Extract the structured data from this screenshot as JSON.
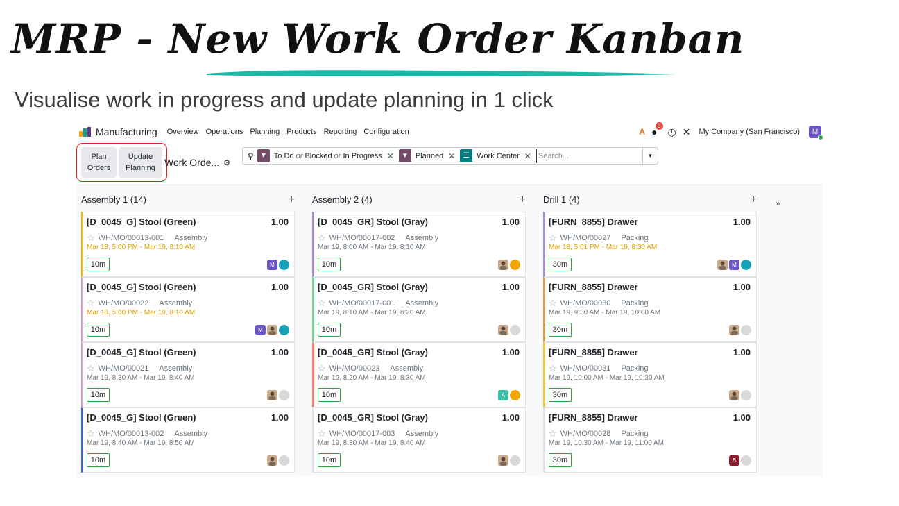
{
  "slide": {
    "title": "MRP - New Work Order Kanban",
    "subtitle": "Visualise work in progress and update planning in 1 click"
  },
  "navbar": {
    "app_name": "Manufacturing",
    "menu": [
      "Overview",
      "Operations",
      "Planning",
      "Products",
      "Reporting",
      "Configuration"
    ],
    "chat_badge": "3",
    "company": "My Company (San Francisco)",
    "user_initial": "M"
  },
  "control": {
    "plan_orders": [
      "Plan",
      "Orders"
    ],
    "update_planning": [
      "Update",
      "Planning"
    ],
    "breadcrumb": "Work Orde..."
  },
  "search": {
    "facets": [
      {
        "parts": [
          "To Do",
          " or ",
          "Blocked",
          " or ",
          "In Progress"
        ],
        "color": "#714B67",
        "icon": "filter-icon"
      },
      {
        "parts": [
          "Planned"
        ],
        "color": "#714B67",
        "icon": "filter-icon"
      },
      {
        "parts": [
          "Work Center"
        ],
        "color": "#017E84",
        "icon": "layers-icon"
      }
    ],
    "placeholder": "Search..."
  },
  "colors": {
    "accent": "#714B67",
    "teal": "#017E84",
    "highlight": "#e02020",
    "brush": "#1bb9a6",
    "late": "#e0a000",
    "duration_border": "#28a745"
  },
  "columns": [
    {
      "title": "Assembly 1 (14)",
      "cards": [
        {
          "title": "[D_0045_G] Stool (Green)",
          "qty": "1.00",
          "ref": "WH/MO/00013-001",
          "wc": "Assembly",
          "date": "Mar 18, 5:00 PM  -  Mar 19, 8:10 AM",
          "late": true,
          "duration": "10m",
          "color": "#f0b429",
          "avatars": [
            {
              "type": "initial",
              "text": "M",
              "color": "#6c56c4"
            },
            {
              "type": "dot",
              "color": "#17a2b8"
            }
          ]
        },
        {
          "title": "[D_0045_G] Stool (Green)",
          "qty": "1.00",
          "ref": "WH/MO/00022",
          "wc": "Assembly",
          "date": "Mar 18, 5:00 PM  -  Mar 19, 8:10 AM",
          "late": true,
          "duration": "10m",
          "color": "#c9a2c1",
          "avatars": [
            {
              "type": "initial",
              "text": "M",
              "color": "#6c56c4"
            },
            {
              "type": "photo"
            },
            {
              "type": "dot",
              "color": "#17a2b8"
            }
          ]
        },
        {
          "title": "[D_0045_G] Stool (Green)",
          "qty": "1.00",
          "ref": "WH/MO/00021",
          "wc": "Assembly",
          "date": "Mar 19, 8:30 AM  -  Mar 19, 8:40 AM",
          "late": false,
          "duration": "10m",
          "color": "#c9a2c1",
          "avatars": [
            {
              "type": "photo"
            },
            {
              "type": "dot",
              "color": "#d9d9d9"
            }
          ]
        },
        {
          "title": "[D_0045_G] Stool (Green)",
          "qty": "1.00",
          "ref": "WH/MO/00013-002",
          "wc": "Assembly",
          "date": "Mar 19, 8:40 AM  -  Mar 19, 8:50 AM",
          "late": false,
          "duration": "10m",
          "color": "#4a63c7",
          "avatars": [
            {
              "type": "photo"
            },
            {
              "type": "dot",
              "color": "#d9d9d9"
            }
          ]
        }
      ]
    },
    {
      "title": "Assembly 2 (4)",
      "cards": [
        {
          "title": "[D_0045_GR] Stool (Gray)",
          "qty": "1.00",
          "ref": "WH/MO/00017-002",
          "wc": "Assembly",
          "date": "Mar 19, 8:00 AM  -  Mar 19, 8:10 AM",
          "late": false,
          "duration": "10m",
          "color": "#a78bd4",
          "avatars": [
            {
              "type": "photo"
            },
            {
              "type": "dot",
              "color": "#f0a500"
            }
          ]
        },
        {
          "title": "[D_0045_GR] Stool (Gray)",
          "qty": "1.00",
          "ref": "WH/MO/00017-001",
          "wc": "Assembly",
          "date": "Mar 19, 8:10 AM  -  Mar 19, 8:20 AM",
          "late": false,
          "duration": "10m",
          "color": "#7ccf91",
          "avatars": [
            {
              "type": "photo"
            },
            {
              "type": "dot",
              "color": "#d9d9d9"
            }
          ]
        },
        {
          "title": "[D_0045_GR] Stool (Gray)",
          "qty": "1.00",
          "ref": "WH/MO/00023",
          "wc": "Assembly",
          "date": "Mar 19, 8:20 AM  -  Mar 19, 8:30 AM",
          "late": false,
          "duration": "10m",
          "color": "#e8826b",
          "avatars": [
            {
              "type": "initial",
              "text": "A",
              "color": "#3cbfa8"
            },
            {
              "type": "dot",
              "color": "#f0a500"
            }
          ]
        },
        {
          "title": "[D_0045_GR] Stool (Gray)",
          "qty": "1.00",
          "ref": "WH/MO/00017-003",
          "wc": "Assembly",
          "date": "Mar 19, 8:30 AM  -  Mar 19, 8:40 AM",
          "late": false,
          "duration": "10m",
          "color": "#dee2e6",
          "avatars": [
            {
              "type": "photo"
            },
            {
              "type": "dot",
              "color": "#d9d9d9"
            }
          ]
        }
      ]
    },
    {
      "title": "Drill 1 (4)",
      "cards": [
        {
          "title": "[FURN_8855] Drawer",
          "qty": "1.00",
          "ref": "WH/MO/00027",
          "wc": "Packing",
          "date": "Mar 18, 5:01 PM  -  Mar 19, 8:30 AM",
          "late": true,
          "duration": "30m",
          "color": "#a78bd4",
          "avatars": [
            {
              "type": "photo"
            },
            {
              "type": "initial",
              "text": "M",
              "color": "#6c56c4"
            },
            {
              "type": "dot",
              "color": "#17a2b8"
            }
          ]
        },
        {
          "title": "[FURN_8855] Drawer",
          "qty": "1.00",
          "ref": "WH/MO/00030",
          "wc": "Packing",
          "date": "Mar 19, 9:30 AM  -  Mar 19, 10:00 AM",
          "late": false,
          "duration": "30m",
          "color": "#e09a4a",
          "avatars": [
            {
              "type": "photo"
            },
            {
              "type": "dot",
              "color": "#d9d9d9"
            }
          ]
        },
        {
          "title": "[FURN_8855] Drawer",
          "qty": "1.00",
          "ref": "WH/MO/00031",
          "wc": "Packing",
          "date": "Mar 19, 10:00 AM  -  Mar 19, 10:30 AM",
          "late": false,
          "duration": "30m",
          "color": "#f0c43a",
          "avatars": [
            {
              "type": "photo"
            },
            {
              "type": "dot",
              "color": "#d9d9d9"
            }
          ]
        },
        {
          "title": "[FURN_8855] Drawer",
          "qty": "1.00",
          "ref": "WH/MO/00028",
          "wc": "Packing",
          "date": "Mar 19, 10:30 AM  -  Mar 19, 11:00 AM",
          "late": false,
          "duration": "30m",
          "color": "#dee2e6",
          "avatars": [
            {
              "type": "initial",
              "text": "B",
              "color": "#8b1c2c"
            },
            {
              "type": "dot",
              "color": "#d9d9d9"
            }
          ]
        }
      ]
    }
  ]
}
